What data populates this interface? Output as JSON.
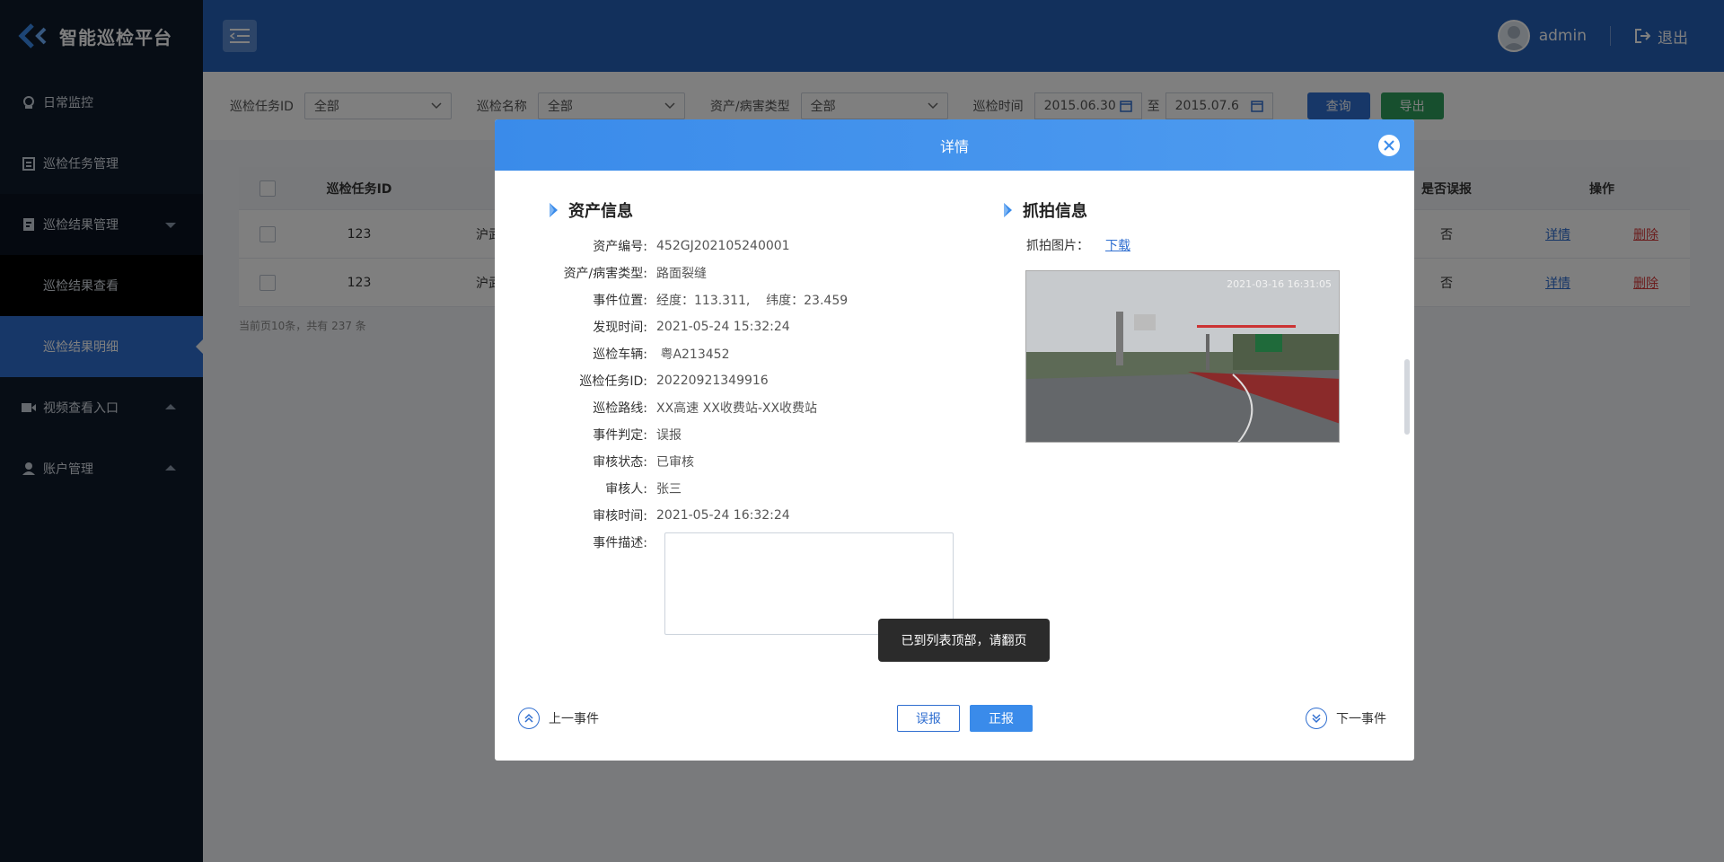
{
  "app": {
    "title": "智能巡检平台"
  },
  "sidebar": {
    "items": [
      {
        "label": "日常监控",
        "icon": "monitor-icon"
      },
      {
        "label": "巡检任务管理",
        "icon": "clipboard-icon"
      },
      {
        "label": "巡检结果管理",
        "icon": "report-icon",
        "expanded": true,
        "children": [
          {
            "label": "巡检结果查看"
          },
          {
            "label": "巡检结果明细",
            "active": true
          }
        ]
      },
      {
        "label": "视频查看入口",
        "icon": "video-icon"
      },
      {
        "label": "账户管理",
        "icon": "user-icon"
      }
    ]
  },
  "header": {
    "username": "admin",
    "logout_label": "退出"
  },
  "filters": {
    "task_id_label": "巡检任务ID",
    "task_id_value": "全部",
    "name_label": "巡检名称",
    "name_value": "全部",
    "type_label": "资产/病害类型",
    "type_value": "全部",
    "time_label": "巡检时间",
    "time_from": "2015.06.30",
    "time_sep": "至",
    "time_to": "2015.07.6",
    "query_label": "查询",
    "export_label": "导出"
  },
  "table": {
    "columns": {
      "task_id": "巡检任务ID",
      "false_report": "是否误报",
      "operation": "操作"
    },
    "rows": [
      {
        "task_id": "123",
        "name": "沪武",
        "false_report": "否",
        "detail": "详情",
        "delete": "删除"
      },
      {
        "task_id": "123",
        "name": "沪武",
        "false_report": "否",
        "detail": "详情",
        "delete": "删除"
      }
    ],
    "pager_note": "当前页10条，共有 237 条"
  },
  "modal": {
    "title": "详情",
    "asset_section": "资产信息",
    "capture_section": "抓拍信息",
    "fields": [
      {
        "k": "资产编号:",
        "v": "452GJ202105240001"
      },
      {
        "k": "资产/病害类型:",
        "v": "路面裂缝"
      },
      {
        "k": "事件位置:",
        "v": "经度：113.311,    纬度：23.459"
      },
      {
        "k": "发现时间:",
        "v": "2021-05-24 15:32:24"
      },
      {
        "k": "巡检车辆:",
        "v": " 粤A213452"
      },
      {
        "k": "巡检任务ID:",
        "v": "20220921349916"
      },
      {
        "k": "巡检路线:",
        "v": "XX高速 XX收费站-XX收费站"
      },
      {
        "k": "事件判定:",
        "v": "误报"
      },
      {
        "k": "审核状态:",
        "v": "已审核"
      },
      {
        "k": "审核人:",
        "v": "张三"
      },
      {
        "k": "审核时间:",
        "v": "2021-05-24 16:32:24"
      },
      {
        "k": "事件描述:",
        "v": ""
      }
    ],
    "capture_label": "抓拍图片：",
    "download_label": "下载",
    "photo_timestamp": "2021-03-16 16:31:05",
    "toast": "已到列表顶部，请翻页",
    "prev_label": "上一事件",
    "next_label": "下一事件",
    "false_btn": "误报",
    "true_btn": "正报"
  },
  "colors": {
    "primary": "#2f6ed0",
    "header": "#2461b8",
    "sidebar": "#0e1a2b",
    "success": "#2f9e5c",
    "danger": "#d63a3a"
  }
}
